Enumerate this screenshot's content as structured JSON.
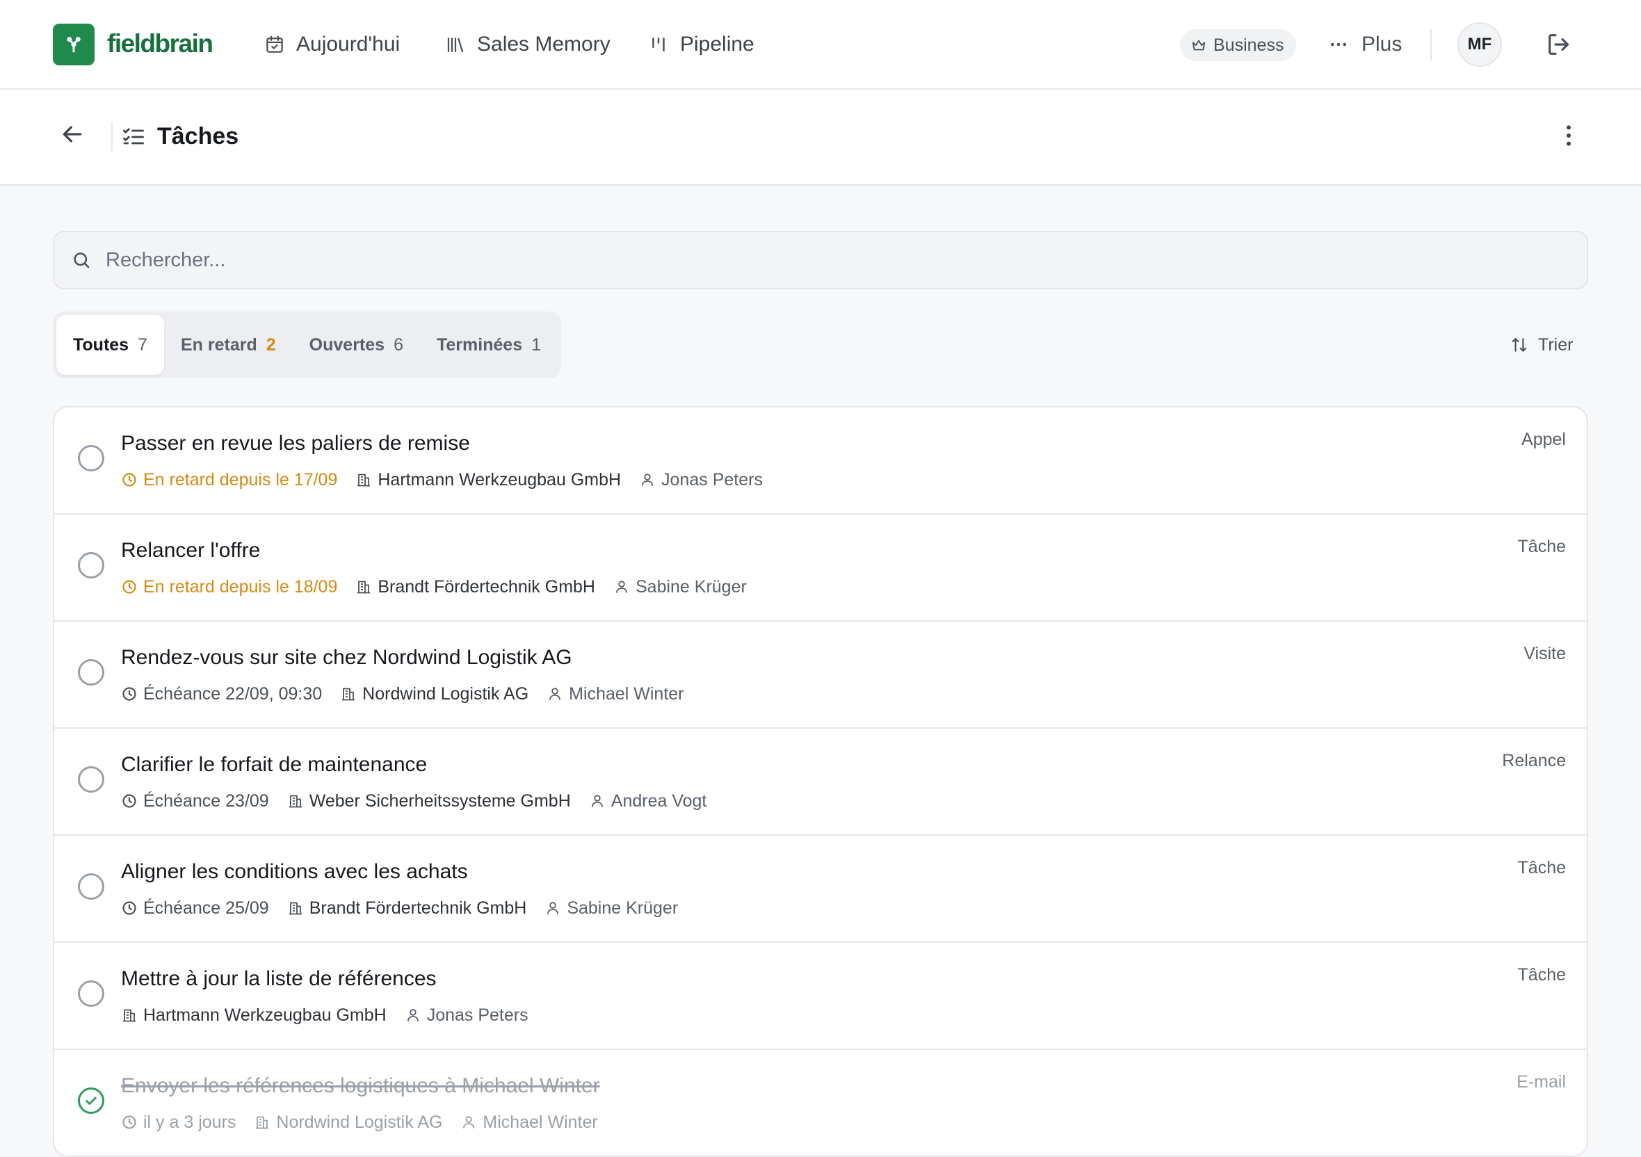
{
  "app": {
    "brand": "fieldbrain",
    "nav": [
      {
        "label": "Aujourd'hui",
        "icon": "calendar-check-icon"
      },
      {
        "label": "Sales Memory",
        "icon": "library-icon"
      },
      {
        "label": "Pipeline",
        "icon": "pipeline-icon"
      }
    ],
    "plan_badge": "Business",
    "more_label": "Plus",
    "user_initials": "MF"
  },
  "page": {
    "title": "Tâches"
  },
  "search": {
    "placeholder": "Rechercher...",
    "value": ""
  },
  "filters": [
    {
      "label": "Toutes",
      "count": "7",
      "active": true
    },
    {
      "label": "En retard",
      "count": "2",
      "warn": true
    },
    {
      "label": "Ouvertes",
      "count": "6"
    },
    {
      "label": "Terminées",
      "count": "1"
    }
  ],
  "sort_label": "Trier",
  "tasks": [
    {
      "title": "Passer en revue les paliers de remise",
      "due": "En retard depuis le 17/09",
      "company": "Hartmann Werkzeugbau GmbH",
      "contact": "Jonas Peters",
      "type": "Appel"
    },
    {
      "title": "Relancer l'offre",
      "due": "En retard depuis le 18/09",
      "company": "Brandt Fördertechnik GmbH",
      "contact": "Sabine Krüger",
      "type": "Tâche"
    },
    {
      "title": "Rendez-vous sur site chez Nordwind Logistik AG",
      "due": "Échéance 22/09, 09:30",
      "company": "Nordwind Logistik AG",
      "contact": "Michael Winter",
      "type": "Visite"
    },
    {
      "title": "Clarifier le forfait de maintenance",
      "due": "Échéance 23/09",
      "company": "Weber Sicherheitssysteme GmbH",
      "contact": "Andrea Vogt",
      "type": "Relance"
    },
    {
      "title": "Aligner les conditions avec les achats",
      "due": "Échéance 25/09",
      "company": "Brandt Fördertechnik GmbH",
      "contact": "Sabine Krüger",
      "type": "Tâche"
    },
    {
      "title": "Mettre à jour la liste de références",
      "due": "",
      "company": "Hartmann Werkzeugbau GmbH",
      "contact": "Jonas Peters",
      "type": "Tâche"
    },
    {
      "title": "Envoyer les références logistiques à Michael Winter",
      "due": "il y a 3 jours",
      "company": "Nordwind Logistik AG",
      "contact": "Michael Winter",
      "type": "E-mail"
    }
  ],
  "colors": {
    "brand_green": "#1f8a4c",
    "overdue": "#d68a13",
    "done_check": "#2e9a5c"
  }
}
